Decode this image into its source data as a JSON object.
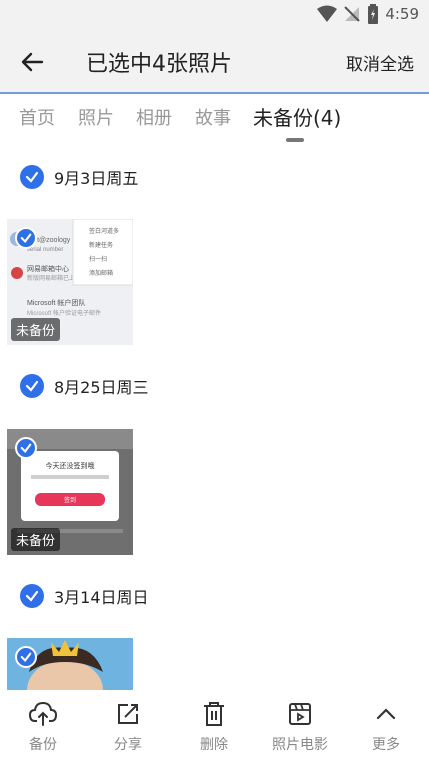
{
  "status": {
    "time": "4:59"
  },
  "header": {
    "title": "已选中4张照片",
    "action": "取消全选"
  },
  "tabs": [
    {
      "label": "首页"
    },
    {
      "label": "照片"
    },
    {
      "label": "相册"
    },
    {
      "label": "故事"
    },
    {
      "label": "未备份(4)"
    }
  ],
  "sections": [
    {
      "date": "9月3日周五",
      "badge": "未备份"
    },
    {
      "date": "8月25日周三",
      "badge": "未备份"
    },
    {
      "date": "3月14日周日"
    }
  ],
  "thumbs": {
    "t1": {
      "rows": [
        "port@zoology",
        "serial number",
        "网易邮箱中心",
        "新版网易邮箱已上线",
        "Microsoft 帐户团队",
        "Microsoft 帐户验证电子邮件"
      ],
      "menu": [
        "签白河道多",
        "新建任务",
        "扫一扫",
        "添加邮箱"
      ]
    },
    "t2": {
      "popup_title": "今天还没签到哦",
      "popup_button": "签到"
    }
  },
  "bottom_bar": [
    {
      "label": "备份",
      "icon": "cloud-upload-icon"
    },
    {
      "label": "分享",
      "icon": "share-icon"
    },
    {
      "label": "删除",
      "icon": "trash-icon"
    },
    {
      "label": "照片电影",
      "icon": "movie-icon"
    },
    {
      "label": "更多",
      "icon": "chevron-up-icon"
    }
  ],
  "colors": {
    "accent": "#2f6fe8",
    "header_bg": "#f2f2f2",
    "header_border": "#7a9ad6"
  }
}
